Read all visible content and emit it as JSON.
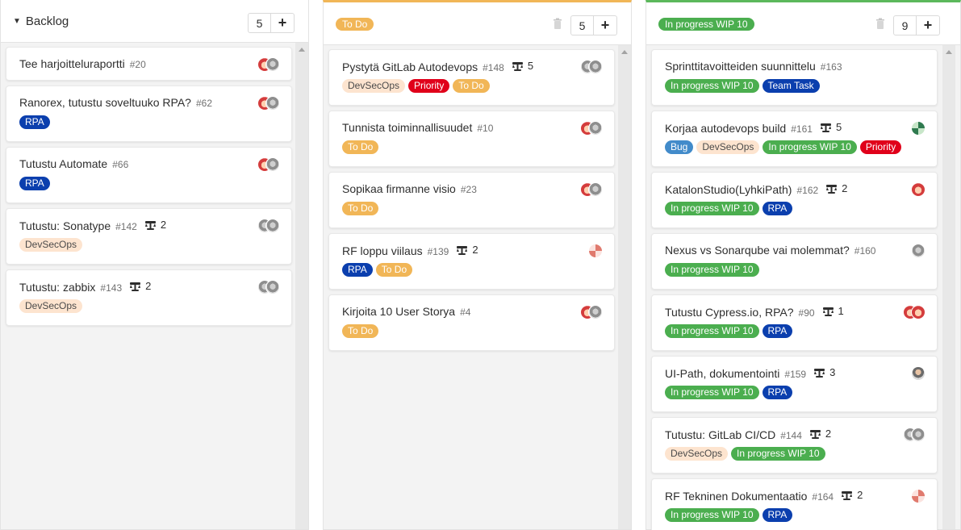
{
  "colors": {
    "rpa": "#0b3fae",
    "devsecops": "#fde4cf",
    "priority": "#e0001a",
    "todo": "#f1b657",
    "inprogress": "#4bae4f",
    "teamtask": "#0b3fae",
    "bug": "#428bca"
  },
  "columns": [
    {
      "title": "Backlog",
      "count": "5",
      "add_label": "+",
      "cards": [
        {
          "title": "Tee harjoitteluraportti",
          "number": "#20",
          "weight": "",
          "labels": [],
          "avatars": [
            "red",
            "gray"
          ]
        },
        {
          "title": "Ranorex, tutustu soveltuuko RPA?",
          "number": "#62",
          "weight": "",
          "labels": [
            "RPA"
          ],
          "avatars": [
            "red",
            "gray"
          ]
        },
        {
          "title": "Tutustu Automate",
          "number": "#66",
          "weight": "",
          "labels": [
            "RPA"
          ],
          "avatars": [
            "red",
            "gray"
          ]
        },
        {
          "title": "Tutustu: Sonatype",
          "number": "#142",
          "weight": "2",
          "labels": [
            "DevSecOps"
          ],
          "avatars": [
            "gray",
            "gray"
          ]
        },
        {
          "title": "Tutustu: zabbix",
          "number": "#143",
          "weight": "2",
          "labels": [
            "DevSecOps"
          ],
          "avatars": [
            "gray",
            "gray"
          ]
        }
      ]
    },
    {
      "title": "To Do",
      "count": "5",
      "add_label": "+",
      "cards": [
        {
          "title": "Pystytä GitLab Autodevops",
          "number": "#148",
          "weight": "5",
          "labels": [
            "DevSecOps",
            "Priority",
            "To Do"
          ],
          "avatars": [
            "gray",
            "gray"
          ]
        },
        {
          "title": "Tunnista toiminnallisuudet",
          "number": "#10",
          "weight": "",
          "labels": [
            "To Do"
          ],
          "avatars": [
            "red",
            "gray"
          ]
        },
        {
          "title": "Sopikaa firmanne visio",
          "number": "#23",
          "weight": "",
          "labels": [
            "To Do"
          ],
          "avatars": [
            "red",
            "gray"
          ]
        },
        {
          "title": "RF loppu viilaus",
          "number": "#139",
          "weight": "2",
          "labels": [
            "RPA",
            "To Do"
          ],
          "avatars": [
            "pink"
          ]
        },
        {
          "title": "Kirjoita 10 User Storya",
          "number": "#4",
          "weight": "",
          "labels": [
            "To Do"
          ],
          "avatars": [
            "red",
            "gray"
          ]
        }
      ]
    },
    {
      "title": "In progress WIP 10",
      "count": "9",
      "add_label": "+",
      "cards": [
        {
          "title": "Sprinttitavoitteiden suunnittelu",
          "number": "#163",
          "weight": "",
          "labels": [
            "In progress WIP 10",
            "Team Task"
          ],
          "avatars": []
        },
        {
          "title": "Korjaa autodevops build",
          "number": "#161",
          "weight": "5",
          "labels": [
            "Bug",
            "DevSecOps",
            "In progress WIP 10",
            "Priority"
          ],
          "avatars": [
            "green"
          ]
        },
        {
          "title": "KatalonStudio(LyhkiPath)",
          "number": "#162",
          "weight": "2",
          "labels": [
            "In progress WIP 10",
            "RPA"
          ],
          "avatars": [
            "red"
          ]
        },
        {
          "title": "Nexus vs Sonarqube vai molemmat?",
          "number": "#160",
          "weight": "",
          "labels": [
            "In progress WIP 10"
          ],
          "avatars": [
            "gray"
          ]
        },
        {
          "title": "Tutustu Cypress.io, RPA?",
          "number": "#90",
          "weight": "1",
          "labels": [
            "In progress WIP 10",
            "RPA"
          ],
          "avatars": [
            "red",
            "red"
          ]
        },
        {
          "title": "UI-Path, dokumentointi",
          "number": "#159",
          "weight": "3",
          "labels": [
            "In progress WIP 10",
            "RPA"
          ],
          "avatars": [
            "person"
          ]
        },
        {
          "title": "Tutustu: GitLab CI/CD",
          "number": "#144",
          "weight": "2",
          "labels": [
            "DevSecOps",
            "In progress WIP 10"
          ],
          "avatars": [
            "gray",
            "gray"
          ]
        },
        {
          "title": "RF Tekninen Dokumentaatio",
          "number": "#164",
          "weight": "2",
          "labels": [
            "In progress WIP 10",
            "RPA"
          ],
          "avatars": [
            "pink"
          ]
        }
      ]
    }
  ]
}
